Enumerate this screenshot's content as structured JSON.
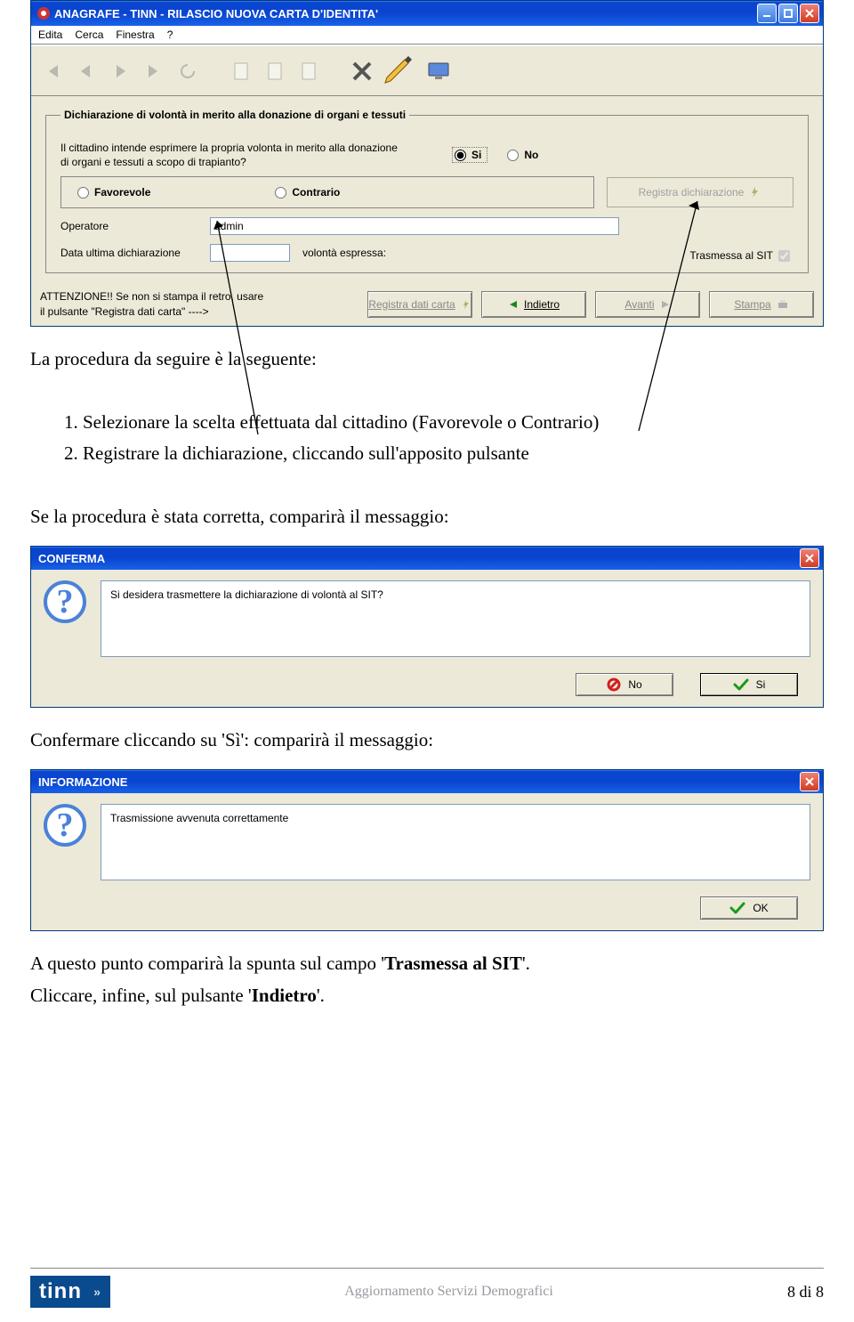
{
  "window": {
    "title": "ANAGRAFE - TINN - RILASCIO NUOVA CARTA D'IDENTITA'",
    "menu": {
      "edita": "Edita",
      "cerca": "Cerca",
      "finestra": "Finestra",
      "help": "?"
    }
  },
  "group": {
    "legend": "Dichiarazione di volontà in merito alla donazione di organi e tessuti",
    "question": "Il cittadino intende esprimere la propria volonta in merito alla donazione di organi e tessuti a scopo di trapianto?",
    "si": "Si",
    "no": "No",
    "favorevole": "Favorevole",
    "contrario": "Contrario",
    "registra_btn": "Registra dichiarazione",
    "operatore_lbl": "Operatore",
    "operatore_val": "admin",
    "data_decl_lbl": "Data ultima dichiarazione",
    "volonta_lbl": "volontà espressa:",
    "trasmessa_lbl": "Trasmessa al SIT"
  },
  "bottombar": {
    "attn1": "ATTENZIONE!!  Se non si stampa il retro, usare",
    "attn2": "il pulsante \"Registra dati carta\" ---->",
    "registra": "Registra dati carta",
    "indietro": "Indietro",
    "avanti": "Avanti",
    "stampa": "Stampa"
  },
  "text": {
    "intro": "La procedura da seguire è la seguente:",
    "step1": "1.   Selezionare la scelta effettuata dal cittadino (Favorevole o Contrario)",
    "step2": "2.   Registrare la dichiarazione, cliccando sull'apposito pulsante",
    "after": "Se la procedura è stata corretta, comparirà il messaggio:",
    "confirm": "Confermare cliccando su 'Sì': comparirà il messaggio:",
    "final1": "A questo punto comparirà la spunta sul campo 'Trasmessa al SIT'.",
    "final2": "Cliccare, infine, sul pulsante 'Indietro'."
  },
  "dlg1": {
    "title": "CONFERMA",
    "msg": "Si desidera trasmettere la dichiarazione di volontà al SIT?",
    "no": "No",
    "si": "Si"
  },
  "dlg2": {
    "title": "INFORMAZIONE",
    "msg": "Trasmissione avvenuta correttamente",
    "ok": "OK"
  },
  "footer": {
    "logo": "tinn",
    "doc": "Aggiornamento Servizi Demografici",
    "page": "8 di 8"
  }
}
